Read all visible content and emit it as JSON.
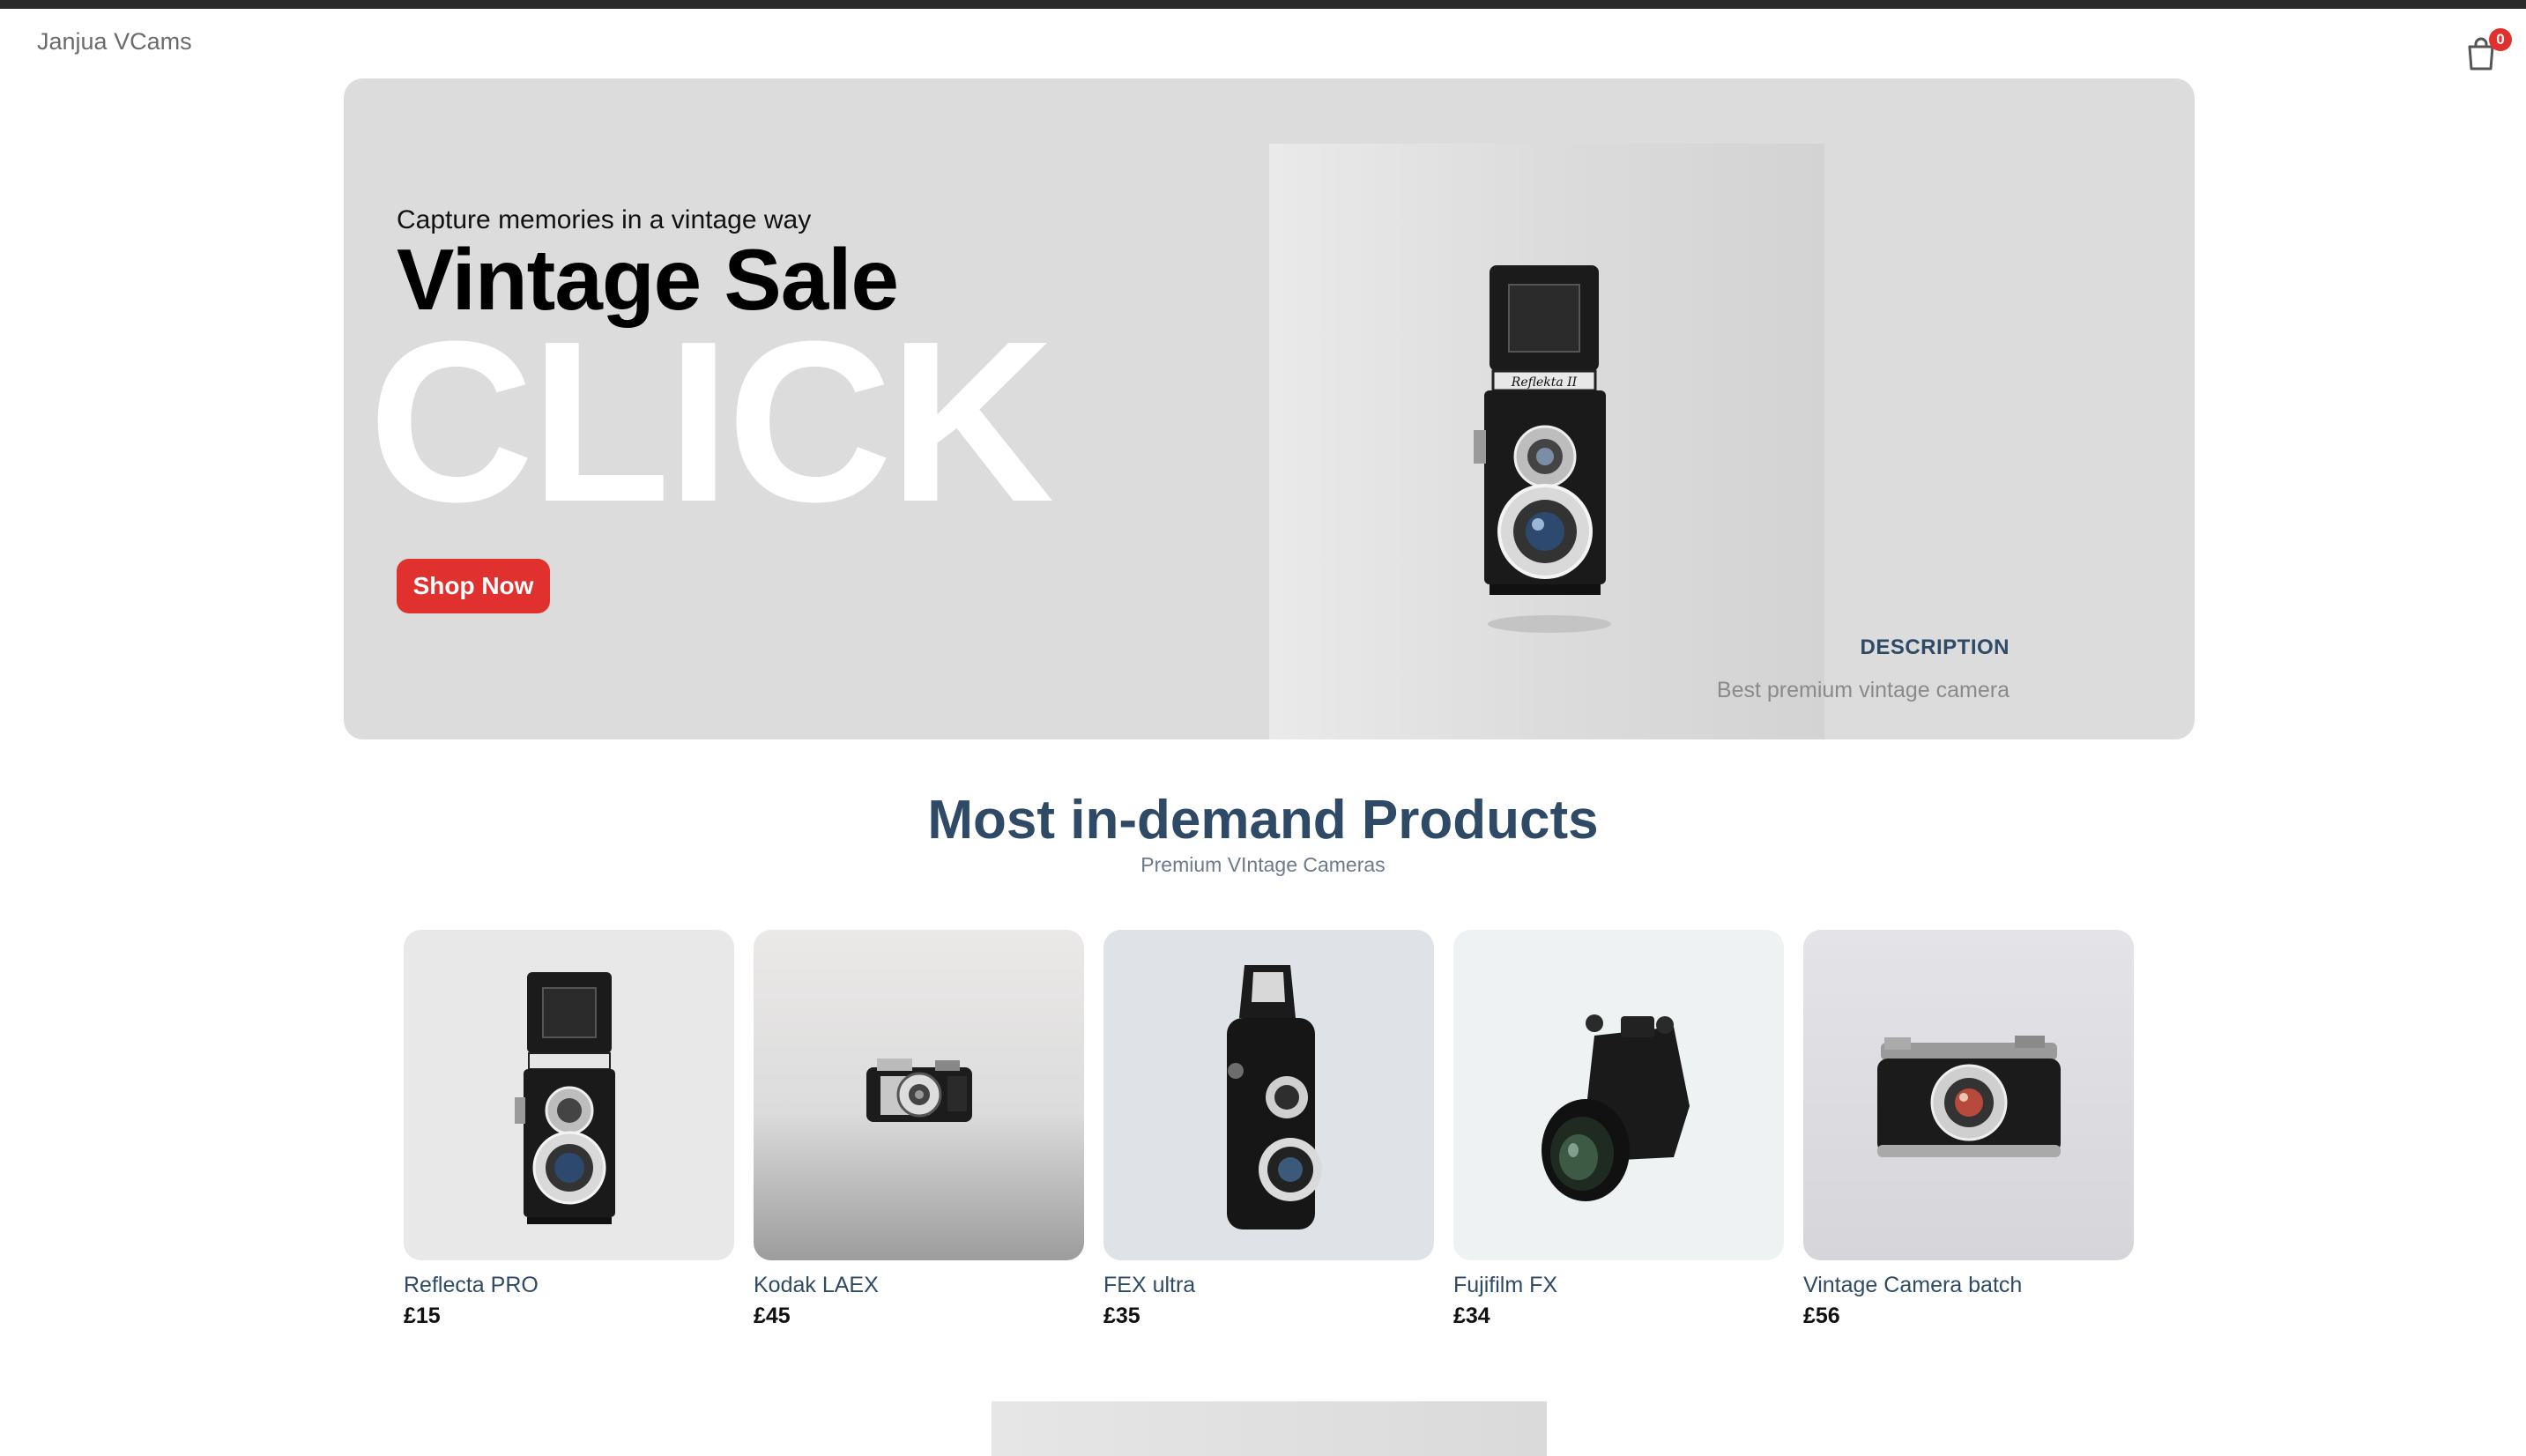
{
  "header": {
    "logo": "Janjua VCams",
    "cart_count": "0"
  },
  "hero": {
    "subtitle": "Capture memories in a vintage way",
    "title": "Vintage Sale",
    "big_text": "CLICK",
    "button_label": "Shop Now",
    "description_title": "DESCRIPTION",
    "description_text": "Best premium vintage camera"
  },
  "section": {
    "title": "Most in-demand Products",
    "subtitle": "Premium VIntage Cameras"
  },
  "products": [
    {
      "name": "Reflecta PRO",
      "price": "£15"
    },
    {
      "name": "Kodak LAEX",
      "price": "£45"
    },
    {
      "name": "FEX ultra",
      "price": "£35"
    },
    {
      "name": "Fujifilm FX",
      "price": "£34"
    },
    {
      "name": "Vintage Camera batch",
      "price": "£56"
    }
  ],
  "hero_label_text": "Reflekta II",
  "colors": {
    "accent": "#e0312f",
    "heading": "#2f4a66",
    "hero_bg": "#dcdcdc"
  }
}
